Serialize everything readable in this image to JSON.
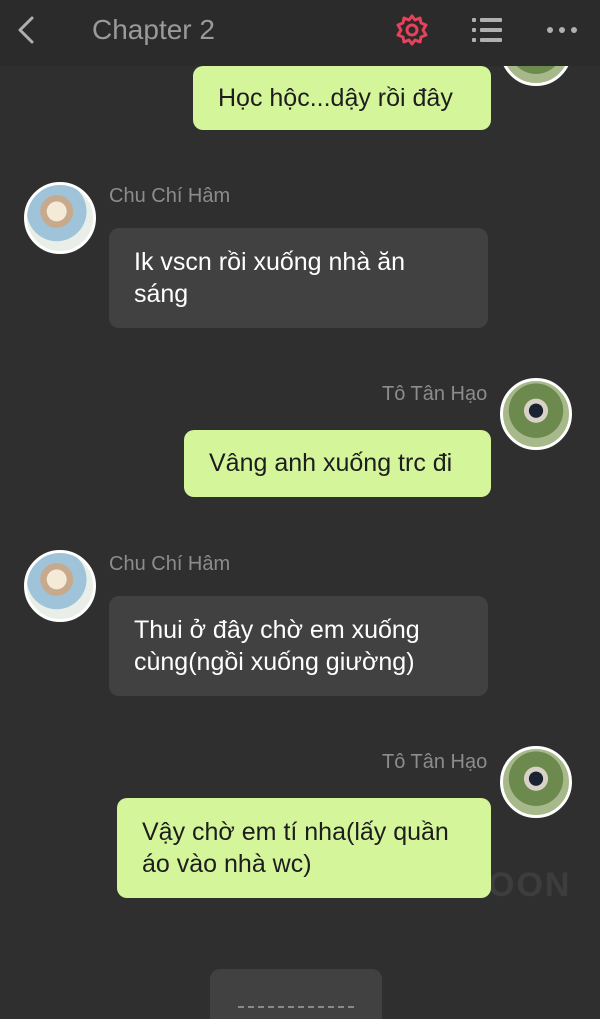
{
  "header": {
    "title": "Chapter 2",
    "back_icon": "back-chevron-icon",
    "settings_icon": "gear-icon",
    "list_icon": "list-icon",
    "more_icon": "more-dots-icon",
    "accent_color": "#e8415b"
  },
  "messages": [
    {
      "side": "right",
      "sender": "",
      "text": "Học hộc...dậy rồi đây"
    },
    {
      "side": "left",
      "sender": "Chu Chí Hâm",
      "text": "Ik vscn rồi xuống nhà ăn sáng"
    },
    {
      "side": "right",
      "sender": "Tô Tân Hạo",
      "text": "Vâng anh xuống trc đi"
    },
    {
      "side": "left",
      "sender": "Chu Chí Hâm",
      "text": "Thui ở đây chờ em xuống cùng(ngồi xuống giường)"
    },
    {
      "side": "right",
      "sender": "Tô Tân Hạo",
      "text": "Vậy chờ em tí nha(lấy quần áo vào nhà wc)"
    }
  ],
  "colors": {
    "background": "#2f2f2f",
    "left_bubble": "#414141",
    "right_bubble": "#d4f59a"
  }
}
